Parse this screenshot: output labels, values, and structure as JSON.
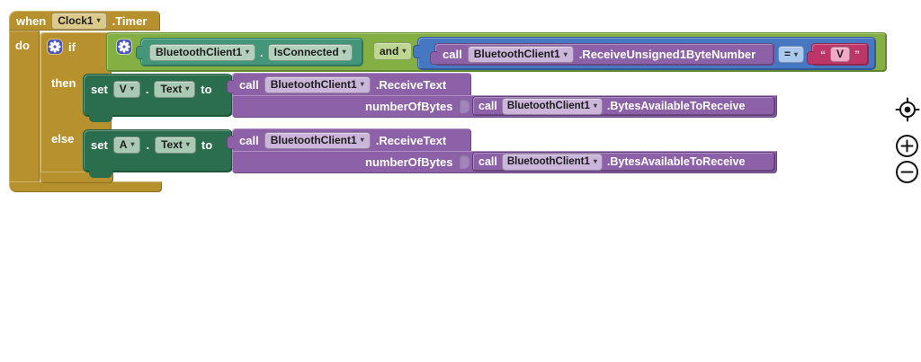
{
  "ui": {
    "caret": "▾",
    "colors": {
      "event_control_gold": "#b6912d",
      "logic_green": "#84b043",
      "getter_teal_green": "#44967a",
      "math_blue": "#4677c2",
      "text_crimson": "#bc3668",
      "call_purple": "#8c61a8",
      "setter_dark_green": "#2b6e4e",
      "mutator_indigo": "#4a54c0",
      "canvas": "#ffffff"
    }
  },
  "when_block": {
    "keyword": "when",
    "component": "Clock1",
    "event": ".Timer",
    "do_label": "do"
  },
  "if_block": {
    "if_label": "if",
    "then_label": "then",
    "else_label": "else"
  },
  "condition": {
    "getter": {
      "component": "BluetoothClient1",
      "dot": ".",
      "property": "IsConnected"
    },
    "and_operator": "and",
    "compare": {
      "call_label": "call",
      "component": "BluetoothClient1",
      "method": ".ReceiveUnsigned1ByteNumber",
      "operator": "=",
      "text_block": {
        "open_quote": "“",
        "value": "V",
        "close_quote": "”"
      }
    }
  },
  "then_branch": {
    "setter": {
      "set_label": "set",
      "variable": "V",
      "dot": ".",
      "property": "Text",
      "to_label": "to"
    },
    "receive_call": {
      "call_label": "call",
      "component": "BluetoothClient1",
      "method": ".ReceiveText",
      "param_label": "numberOfBytes"
    },
    "bytes_call": {
      "call_label": "call",
      "component": "BluetoothClient1",
      "method": ".BytesAvailableToReceive"
    }
  },
  "else_branch": {
    "setter": {
      "set_label": "set",
      "variable": "A",
      "dot": ".",
      "property": "Text",
      "to_label": "to"
    },
    "receive_call": {
      "call_label": "call",
      "component": "BluetoothClient1",
      "method": ".ReceiveText",
      "param_label": "numberOfBytes"
    },
    "bytes_call": {
      "call_label": "call",
      "component": "BluetoothClient1",
      "method": ".BytesAvailableToReceive"
    }
  }
}
